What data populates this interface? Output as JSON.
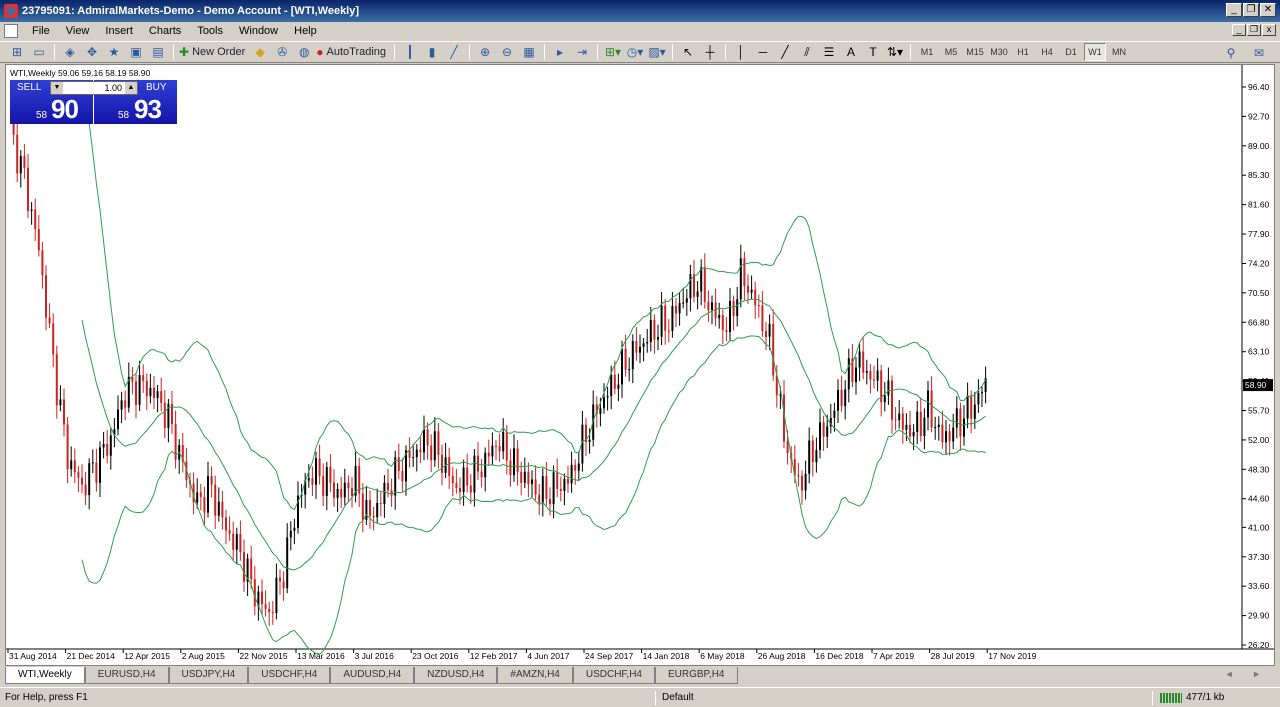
{
  "window": {
    "title": "23795091: AdmiralMarkets-Demo - Demo Account - [WTI,Weekly]",
    "minimize": "_",
    "restore": "❐",
    "close": "✕",
    "mdi_minimize": "_",
    "mdi_restore": "❐",
    "mdi_close": "x"
  },
  "menu": [
    "File",
    "View",
    "Insert",
    "Charts",
    "Tools",
    "Window",
    "Help"
  ],
  "toolbar": {
    "new_order": "New Order",
    "autotrading": "AutoTrading",
    "timeframes": [
      "M1",
      "M5",
      "M15",
      "M30",
      "H1",
      "H4",
      "D1",
      "W1",
      "MN"
    ],
    "active_timeframe": "W1"
  },
  "chart": {
    "symbol_header": "WTI,Weekly  59.06 59.16 58.19 58.90",
    "current_price_label": "58.90",
    "line_color": "#2e9e4e",
    "bull_color": "#000000",
    "bear_color": "#cc2222"
  },
  "trade_panel": {
    "sell_label": "SELL",
    "buy_label": "BUY",
    "lot": "1.00",
    "lot_down": "▼",
    "lot_up": "▲",
    "sell_small": "58",
    "sell_big": "90",
    "buy_small": "58",
    "buy_big": "93"
  },
  "chart_data": {
    "type": "candlestick",
    "y_ticks": [
      "96.40",
      "92.70",
      "89.00",
      "85.30",
      "81.60",
      "77.90",
      "74.20",
      "70.50",
      "66.80",
      "63.10",
      "59.40",
      "55.70",
      "52.00",
      "48.30",
      "44.60",
      "41.00",
      "37.30",
      "33.60",
      "29.90",
      "26.20"
    ],
    "x_ticks": [
      "31 Aug 2014",
      "21 Dec 2014",
      "12 Apr 2015",
      "2 Aug 2015",
      "22 Nov 2015",
      "13 Mar 2016",
      "3 Jul 2016",
      "23 Oct 2016",
      "12 Feb 2017",
      "4 Jun 2017",
      "24 Sep 2017",
      "14 Jan 2018",
      "6 May 2018",
      "26 Aug 2018",
      "16 Dec 2018",
      "7 Apr 2019",
      "28 Jul 2019",
      "17 Nov 2019"
    ],
    "ylim": [
      26.2,
      96.4
    ],
    "close_path": [
      91,
      85,
      76,
      62,
      50,
      46,
      49,
      52,
      58,
      59,
      58,
      55,
      49,
      44,
      46,
      41,
      38,
      33,
      30,
      35,
      44,
      48,
      47,
      45,
      47,
      42,
      45,
      48,
      50,
      52,
      50,
      46,
      47,
      49,
      52,
      49,
      47,
      45,
      46,
      47,
      52,
      56,
      59,
      62,
      64,
      66,
      67,
      70,
      72,
      68,
      66,
      73,
      69,
      64,
      52,
      46,
      51,
      54,
      58,
      62,
      60,
      58,
      54,
      53,
      56,
      52,
      54,
      56,
      58.9
    ]
  },
  "tabs": [
    "WTI,Weekly",
    "EURUSD,H4",
    "USDJPY,H4",
    "USDCHF,H4",
    "AUDUSD,H4",
    "NZDUSD,H4",
    "#AMZN,H4",
    "USDCHF,H4",
    "EURGBP,H4"
  ],
  "tab_arrows": "◄ ►",
  "status": {
    "help": "For Help, press F1",
    "profile": "Default",
    "traffic": "477/1 kb"
  }
}
